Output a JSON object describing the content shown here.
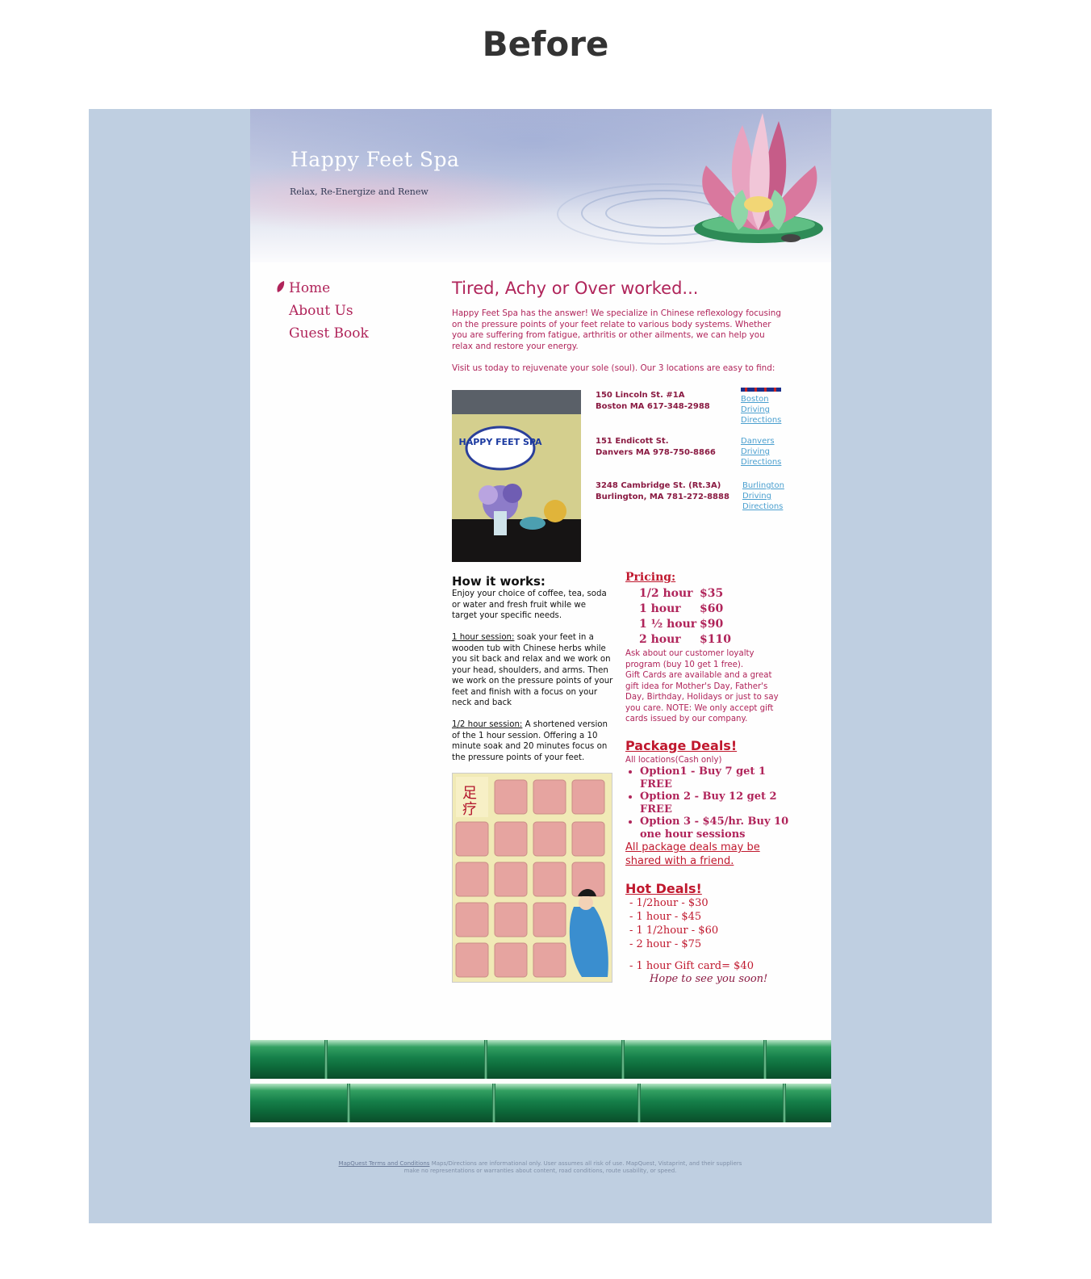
{
  "caption": "Before",
  "header": {
    "site_title": "Happy Feet Spa",
    "tagline": "Relax, Re-Energize and Renew"
  },
  "nav": {
    "items": [
      {
        "label": "Home"
      },
      {
        "label": "About Us"
      },
      {
        "label": "Guest Book"
      }
    ]
  },
  "main": {
    "headline": "Tired, Achy or Over worked...",
    "intro": "Happy Feet Spa has the answer! We specialize in Chinese reflexology focusing on the pressure points of your feet relate to various body systems. Whether you are suffering from fatigue, arthritis or other ailments, we can help you relax and restore your energy.",
    "visit": "Visit us today to rejuvenate your sole (soul). Our 3 locations are easy to find:",
    "locations": [
      {
        "line1": "150 Lincoln St. #1A",
        "line2": "Boston MA 617-348-2988",
        "link": [
          "Boston",
          "Driving",
          "Directions"
        ]
      },
      {
        "line1": "151 Endicott St.",
        "line2": "Danvers MA  978-750-8866",
        "link": [
          "Danvers",
          "Driving",
          "Directions"
        ]
      },
      {
        "line1": "3248 Cambridge St. (Rt.3A)",
        "line2": "Burlington, MA  781-272-8888",
        "link": [
          "Burlington",
          "Driving",
          "Directions"
        ]
      }
    ],
    "photo1_sign": "HAPPY FEET SPA",
    "how": {
      "title": "How it works:",
      "intro": "Enjoy your choice of coffee, tea, soda or water and fresh fruit while we target  your specific needs.",
      "session1_label": "1 hour session:",
      "session1_text": " soak your feet in a wooden tub with Chinese herbs while you sit back and relax and we work on your head, shoulders, and arms.  Then we work on the pressure points of your feet and finish with a focus on your neck and back",
      "session2_label": "1/2 hour session:",
      "session2_text": " A shortened version of the 1 hour session. Offering a 10 minute soak and 20 minutes focus on the pressure points of your feet."
    },
    "pricing": {
      "title": "Pricing:",
      "rows": [
        {
          "label": "1/2 hour",
          "price": "$35"
        },
        {
          "label": "1 hour",
          "price": "$60"
        },
        {
          "label": "1 ½  hour",
          "price": "$90"
        },
        {
          "label": "2 hour",
          "price": "$110"
        }
      ],
      "loyalty": "Ask about our customer loyalty program (buy 10 get 1 free).",
      "gift": "Gift Cards are available and a great gift idea for Mother's Day, Father's Day, Birthday, Holidays or just to say you care. NOTE: We only accept gift cards issued by our company."
    },
    "packages": {
      "title": "Package Deals!",
      "subtitle": "All locations(Cash only)",
      "items": [
        "Option1 - Buy 7 get 1 FREE",
        "Option 2 - Buy 12 get 2 FREE",
        "Option 3 - $45/hr. Buy 10 one hour sessions"
      ],
      "share": "All package deals may be shared with a friend."
    },
    "hot": {
      "title": "Hot Deals!",
      "items": [
        "- 1/2hour - $30",
        "- 1 hour - $45",
        "- 1 1/2hour - $60",
        "- 2 hour - $75"
      ],
      "gift": "- 1 hour Gift card= $40",
      "hope": "Hope to see you soon!"
    }
  },
  "footer": {
    "link": "MapQuest Terms and Conditions",
    "text1": " Maps/Directions are informational only. User assumes all risk of use. MapQuest, Vistaprint, and their suppliers",
    "text2": "make no representations or warranties about content, road conditions, route usability, or speed."
  },
  "colors": {
    "accent": "#b0245a",
    "deal_red": "#c0182e",
    "link_blue": "#4a9fcf",
    "frame_bg": "#bfcfe1"
  }
}
